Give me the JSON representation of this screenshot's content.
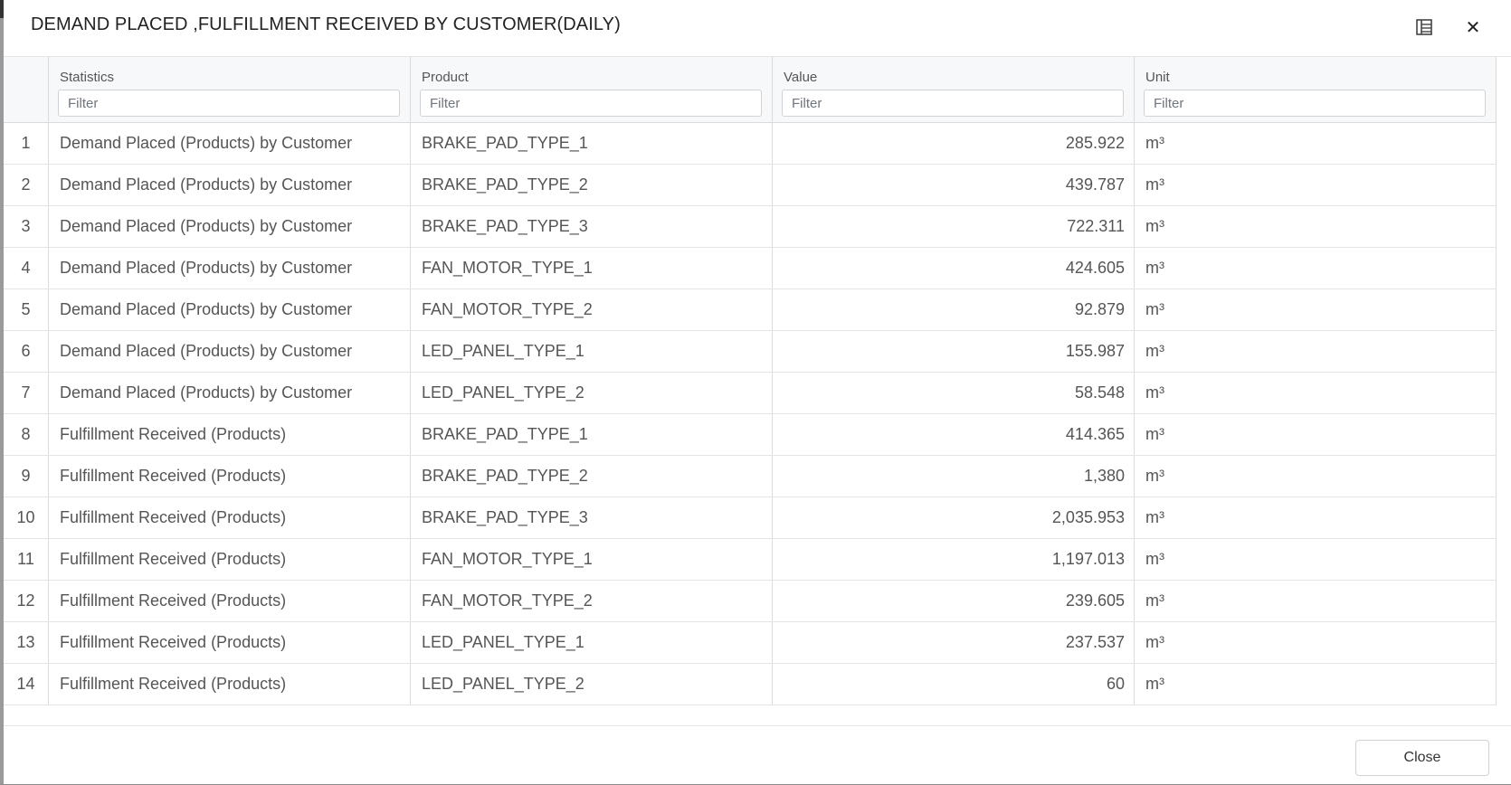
{
  "dialog": {
    "title": "DEMAND PLACED ,FULFILLMENT RECEIVED BY CUSTOMER(DAILY)",
    "columns_icon": "column-chooser-icon",
    "close_icon": "close-icon",
    "close_glyph": "✕"
  },
  "table": {
    "headers": {
      "statistics": "Statistics",
      "product": "Product",
      "value": "Value",
      "unit": "Unit"
    },
    "filter_placeholder": "Filter",
    "rows": [
      {
        "index": "1",
        "statistics": "Demand Placed (Products) by Customer",
        "product": "BRAKE_PAD_TYPE_1",
        "value": "285.922",
        "unit": "m³"
      },
      {
        "index": "2",
        "statistics": "Demand Placed (Products) by Customer",
        "product": "BRAKE_PAD_TYPE_2",
        "value": "439.787",
        "unit": "m³"
      },
      {
        "index": "3",
        "statistics": "Demand Placed (Products) by Customer",
        "product": "BRAKE_PAD_TYPE_3",
        "value": "722.311",
        "unit": "m³"
      },
      {
        "index": "4",
        "statistics": "Demand Placed (Products) by Customer",
        "product": "FAN_MOTOR_TYPE_1",
        "value": "424.605",
        "unit": "m³"
      },
      {
        "index": "5",
        "statistics": "Demand Placed (Products) by Customer",
        "product": "FAN_MOTOR_TYPE_2",
        "value": "92.879",
        "unit": "m³"
      },
      {
        "index": "6",
        "statistics": "Demand Placed (Products) by Customer",
        "product": "LED_PANEL_TYPE_1",
        "value": "155.987",
        "unit": "m³"
      },
      {
        "index": "7",
        "statistics": "Demand Placed (Products) by Customer",
        "product": "LED_PANEL_TYPE_2",
        "value": "58.548",
        "unit": "m³"
      },
      {
        "index": "8",
        "statistics": "Fulfillment Received (Products)",
        "product": "BRAKE_PAD_TYPE_1",
        "value": "414.365",
        "unit": "m³"
      },
      {
        "index": "9",
        "statistics": "Fulfillment Received (Products)",
        "product": "BRAKE_PAD_TYPE_2",
        "value": "1,380",
        "unit": "m³"
      },
      {
        "index": "10",
        "statistics": "Fulfillment Received (Products)",
        "product": "BRAKE_PAD_TYPE_3",
        "value": "2,035.953",
        "unit": "m³"
      },
      {
        "index": "11",
        "statistics": "Fulfillment Received (Products)",
        "product": "FAN_MOTOR_TYPE_1",
        "value": "1,197.013",
        "unit": "m³"
      },
      {
        "index": "12",
        "statistics": "Fulfillment Received (Products)",
        "product": "FAN_MOTOR_TYPE_2",
        "value": "239.605",
        "unit": "m³"
      },
      {
        "index": "13",
        "statistics": "Fulfillment Received (Products)",
        "product": "LED_PANEL_TYPE_1",
        "value": "237.537",
        "unit": "m³"
      },
      {
        "index": "14",
        "statistics": "Fulfillment Received (Products)",
        "product": "LED_PANEL_TYPE_2",
        "value": "60",
        "unit": "m³"
      }
    ]
  },
  "footer": {
    "close_label": "Close"
  }
}
